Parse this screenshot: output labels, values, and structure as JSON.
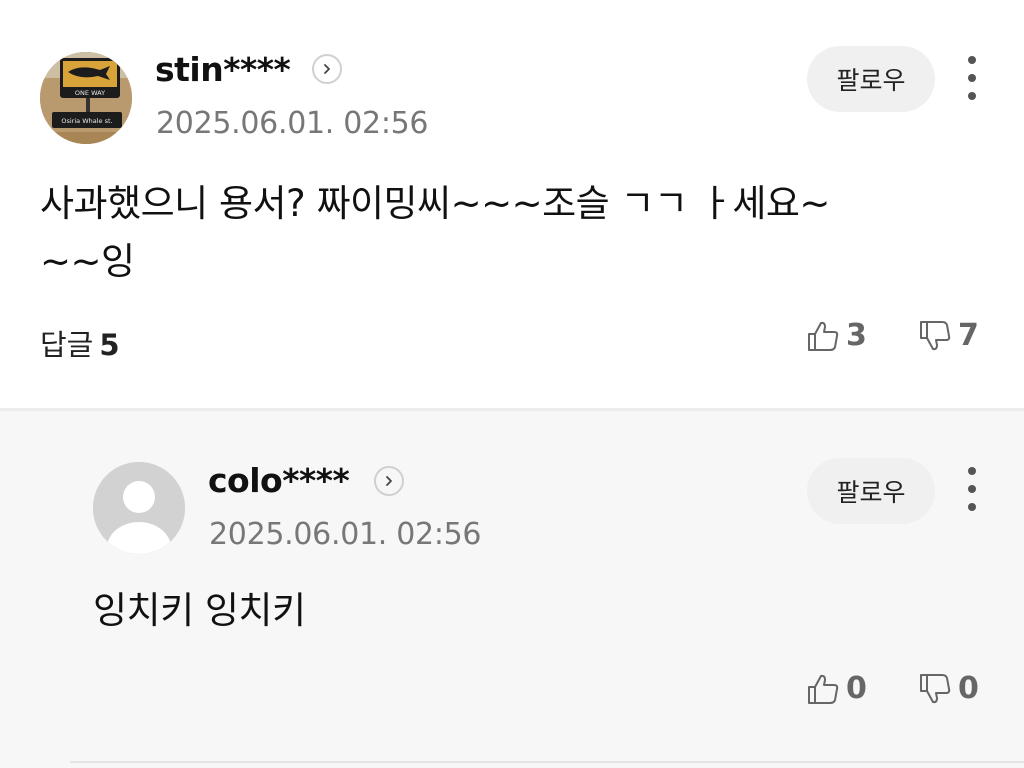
{
  "main_comment": {
    "avatar_sign_top": "ONE WAY",
    "avatar_sign_bottom": "Osiria Whale st.",
    "username": "stin****",
    "timestamp": "2025.06.01. 02:56",
    "follow_label": "팔로우",
    "text_line1": "사과했으니 용서? 짜이밍씨~~~조슬 ㄱㄱ ㅏ세요~",
    "text_line2": "~~잉",
    "replies_label": "답글",
    "replies_count": "5",
    "likes": "3",
    "dislikes": "7"
  },
  "reply_comment": {
    "username": "colo****",
    "timestamp": "2025.06.01. 02:56",
    "follow_label": "팔로우",
    "text": "잉치키 잉치키",
    "likes": "0",
    "dislikes": "0"
  }
}
